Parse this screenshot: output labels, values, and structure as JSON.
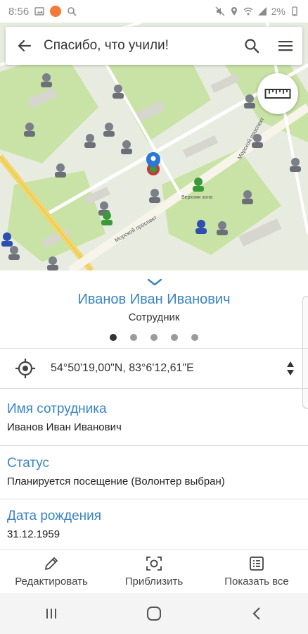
{
  "status_bar": {
    "time": "8:56",
    "battery": "2%"
  },
  "header": {
    "title": "Спасибо, что учили!",
    "back_icon": "arrow-left-icon",
    "search_icon": "search-icon",
    "menu_icon": "hamburger-menu-icon"
  },
  "map": {
    "street_labels": [
      "Морской проспект",
      "Морской проспект",
      "Верхняя зона"
    ],
    "ruler_icon": "ruler-icon"
  },
  "person": {
    "name": "Иванов Иван Иванович",
    "role": "Сотрудник",
    "page_count": 5,
    "active_page": 1
  },
  "location": {
    "coordinates": "54°50'19,00\"N, 83°6'12,61\"E"
  },
  "fields": [
    {
      "label": "Имя сотрудника",
      "value": "Иванов Иван Иванович"
    },
    {
      "label": "Статус",
      "value": "Планируется посещение (Волонтер выбран)"
    },
    {
      "label": "Дата рождения",
      "value": "31.12.1959"
    }
  ],
  "actions": [
    {
      "label": "Редактировать",
      "icon": "pencil-icon"
    },
    {
      "label": "Приблизить",
      "icon": "focus-icon"
    },
    {
      "label": "Показать все",
      "icon": "list-icon"
    }
  ],
  "colors": {
    "accent": "#3a84c3",
    "map_road": "#f3d66a",
    "map_green": "#c8e3a4",
    "marker_blue": "#2a77d6"
  }
}
